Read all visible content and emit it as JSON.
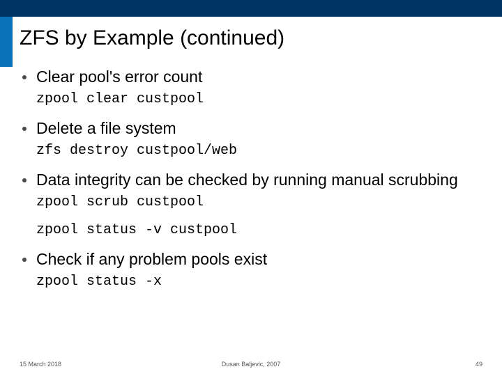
{
  "title": "ZFS by Example (continued)",
  "items": [
    {
      "text": "Clear pool's error count",
      "code": [
        "zpool clear custpool"
      ]
    },
    {
      "text": "Delete a file system",
      "code": [
        "zfs destroy custpool/web"
      ]
    },
    {
      "text": "Data integrity can be checked by running manual scrubbing",
      "code": [
        "zpool scrub custpool",
        "zpool status -v custpool"
      ]
    },
    {
      "text": "Check if any problem pools exist",
      "code": [
        "zpool status -x"
      ]
    }
  ],
  "footer": {
    "date": "15 March 2018",
    "author": "Dusan Baljevic, 2007",
    "page": "49"
  }
}
